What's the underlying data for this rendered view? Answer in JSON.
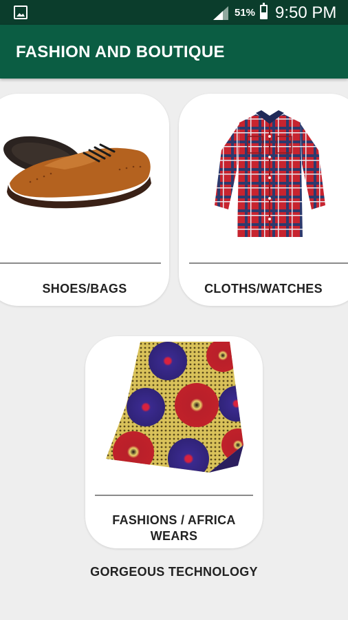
{
  "status_bar": {
    "battery_percent": "51%",
    "time": "9:50 PM",
    "icons": [
      "gallery-icon",
      "signal-icon",
      "battery-icon"
    ]
  },
  "app_bar": {
    "title": "FASHION AND BOUTIQUE"
  },
  "categories": [
    {
      "label": "SHOES/BAGS",
      "image": "brogue-shoe-image"
    },
    {
      "label": "CLOTHS/WATCHES",
      "image": "plaid-shirt-image"
    },
    {
      "label_line1": "FASHIONS / AFRICA",
      "label_line2": "WEARS",
      "image": "ankara-fabric-image"
    }
  ],
  "footer": {
    "text": "GORGEOUS TECHNOLOGY"
  },
  "colors": {
    "status_bar": "#0b3d2c",
    "app_bar": "#0b5d43",
    "background": "#eeeeee"
  }
}
